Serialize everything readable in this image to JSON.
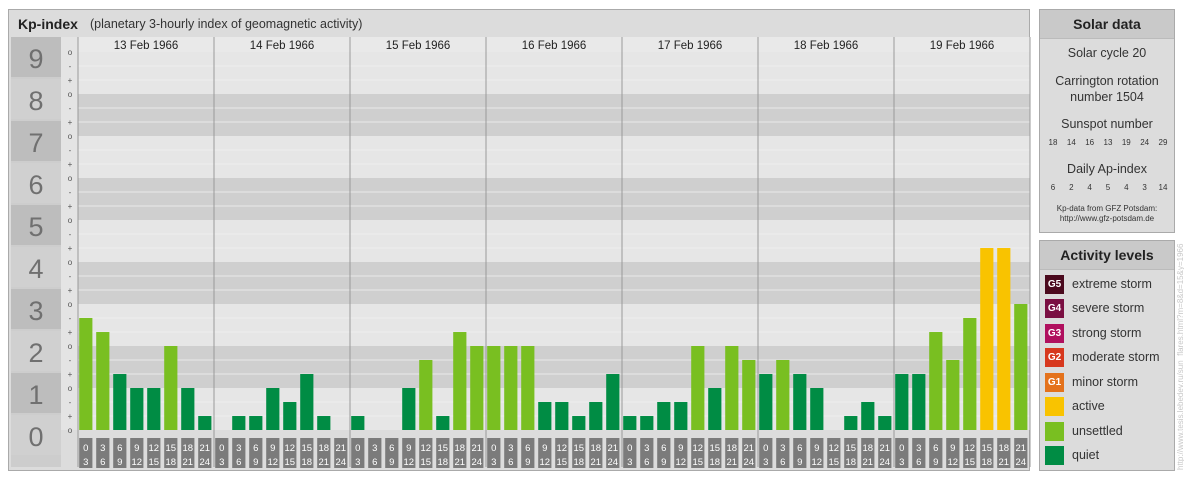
{
  "kp_panel": {
    "title": "Kp-index",
    "subtitle": "(planetary 3-hourly index of geomagnetic activity)"
  },
  "solar": {
    "title": "Solar data",
    "solar_cycle": "Solar cycle 20",
    "carrington_line1": "Carrington rotation",
    "carrington_line2": "number 1504",
    "sunspot_label": "Sunspot number",
    "sunspot_values": [
      "18",
      "14",
      "16",
      "13",
      "19",
      "24",
      "29"
    ],
    "ap_label": "Daily Ap-index",
    "ap_values": [
      "6",
      "2",
      "4",
      "5",
      "4",
      "3",
      "14"
    ],
    "credit_line1": "Kp-data from GFZ Potsdam:",
    "credit_line2": "http://www.gfz-potsdam.de"
  },
  "activity": {
    "title": "Activity levels",
    "items": [
      {
        "badge": "G5",
        "label": "extreme storm",
        "color": "#4b0a1e"
      },
      {
        "badge": "G4",
        "label": "severe storm",
        "color": "#7a0f42"
      },
      {
        "badge": "G3",
        "label": "strong storm",
        "color": "#b0105e"
      },
      {
        "badge": "G2",
        "label": "moderate storm",
        "color": "#d7381e"
      },
      {
        "badge": "G1",
        "label": "minor storm",
        "color": "#e4721c"
      },
      {
        "badge": "",
        "label": "active",
        "color": "#f9c300"
      },
      {
        "badge": "",
        "label": "unsettled",
        "color": "#79bf21"
      },
      {
        "badge": "",
        "label": "quiet",
        "color": "#008c44"
      }
    ]
  },
  "watermark": "http://www.tesis.lebedev.ru/sun_flares.html?m=8&d=15&y=1966",
  "chart_data": {
    "type": "bar",
    "title": "Kp-index",
    "ylim": [
      0,
      9
    ],
    "y_ticks": [
      "0",
      "1",
      "2",
      "3",
      "4",
      "5",
      "6",
      "7",
      "8",
      "9"
    ],
    "y_subticks": [
      "+",
      "o",
      "-"
    ],
    "days": [
      "13 Feb 1966",
      "14 Feb 1966",
      "15 Feb 1966",
      "16 Feb 1966",
      "17 Feb 1966",
      "18 Feb 1966",
      "19 Feb 1966"
    ],
    "interval_starts": [
      "0",
      "3",
      "6",
      "9",
      "12",
      "15",
      "18",
      "21"
    ],
    "interval_ends": [
      "3",
      "6",
      "9",
      "12",
      "15",
      "18",
      "21",
      "24"
    ],
    "values": [
      [
        2.667,
        2.333,
        1.333,
        1.0,
        1.0,
        2.0,
        1.0,
        0.333
      ],
      [
        0.0,
        0.333,
        0.333,
        1.0,
        0.667,
        1.333,
        0.333,
        0.0
      ],
      [
        0.333,
        0.0,
        0.0,
        1.0,
        1.667,
        0.333,
        2.333,
        2.0
      ],
      [
        2.0,
        2.0,
        2.0,
        0.667,
        0.667,
        0.333,
        0.667,
        1.333
      ],
      [
        0.333,
        0.333,
        0.667,
        0.667,
        2.0,
        1.0,
        2.0,
        1.667
      ],
      [
        1.333,
        1.667,
        1.333,
        1.0,
        0.0,
        0.333,
        0.667,
        0.333
      ],
      [
        1.333,
        1.333,
        2.333,
        1.667,
        2.667,
        4.333,
        4.333,
        3.0
      ]
    ],
    "colors": {
      "quiet": "#008c44",
      "unsettled": "#79bf21",
      "active": "#f9c300"
    },
    "grid": true
  }
}
